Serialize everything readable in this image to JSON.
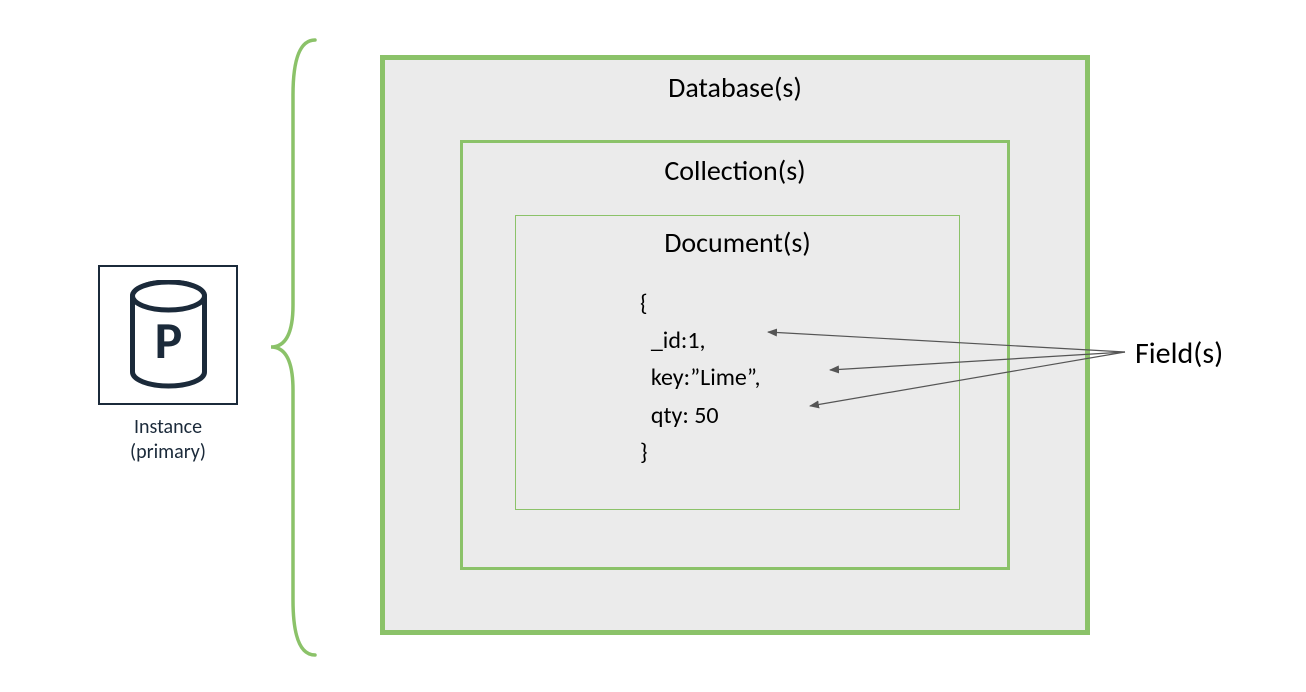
{
  "instance": {
    "letter": "P",
    "label_line1": "Instance",
    "label_line2": "(primary)"
  },
  "boxes": {
    "database_title": "Database(s)",
    "collection_title": "Collection(s)",
    "document_title": "Document(s)"
  },
  "document_json": {
    "open": "{",
    "line1": "  _id:1,",
    "line2": "  key:”Lime”,",
    "line3": "  qty: 50",
    "close": "}"
  },
  "fields_label": "Field(s)"
}
